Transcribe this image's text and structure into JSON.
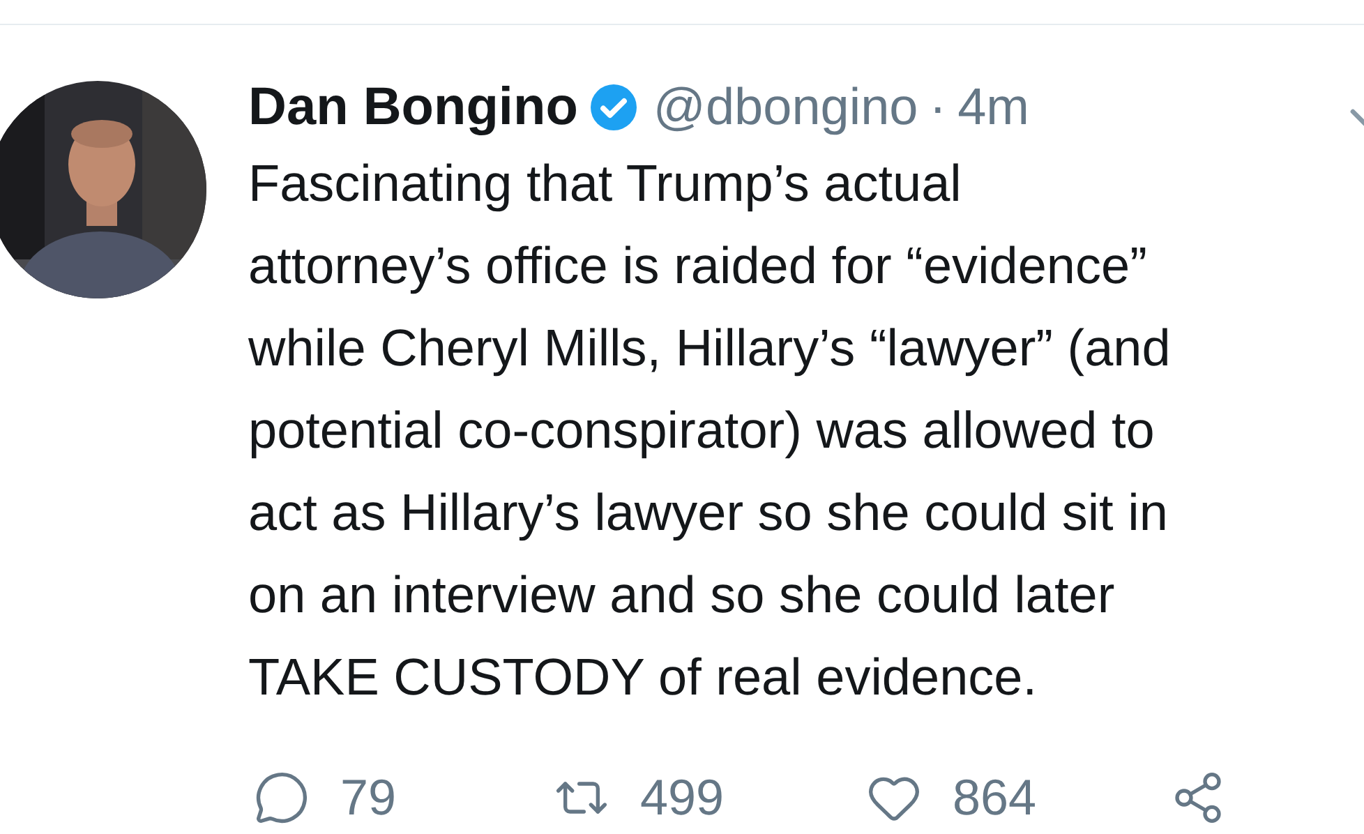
{
  "tweet": {
    "name": "Dan Bongino",
    "verified": true,
    "handle": "@dbongino",
    "separator": "·",
    "time": "4m",
    "text_lines": [
      "Fascinating that Trump’s actual",
      "attorney’s office is raided for “evidence”",
      "while Cheryl Mills, Hillary’s “lawyer” (and",
      "potential co-conspirator) was allowed to",
      "act as Hillary’s lawyer so she could sit in",
      "on an interview and so she could later",
      "TAKE CUSTODY of real evidence."
    ],
    "actions": [
      {
        "kind": "reply",
        "count": "79"
      },
      {
        "kind": "retweet",
        "count": "499"
      },
      {
        "kind": "like",
        "count": "864"
      },
      {
        "kind": "share"
      }
    ]
  }
}
